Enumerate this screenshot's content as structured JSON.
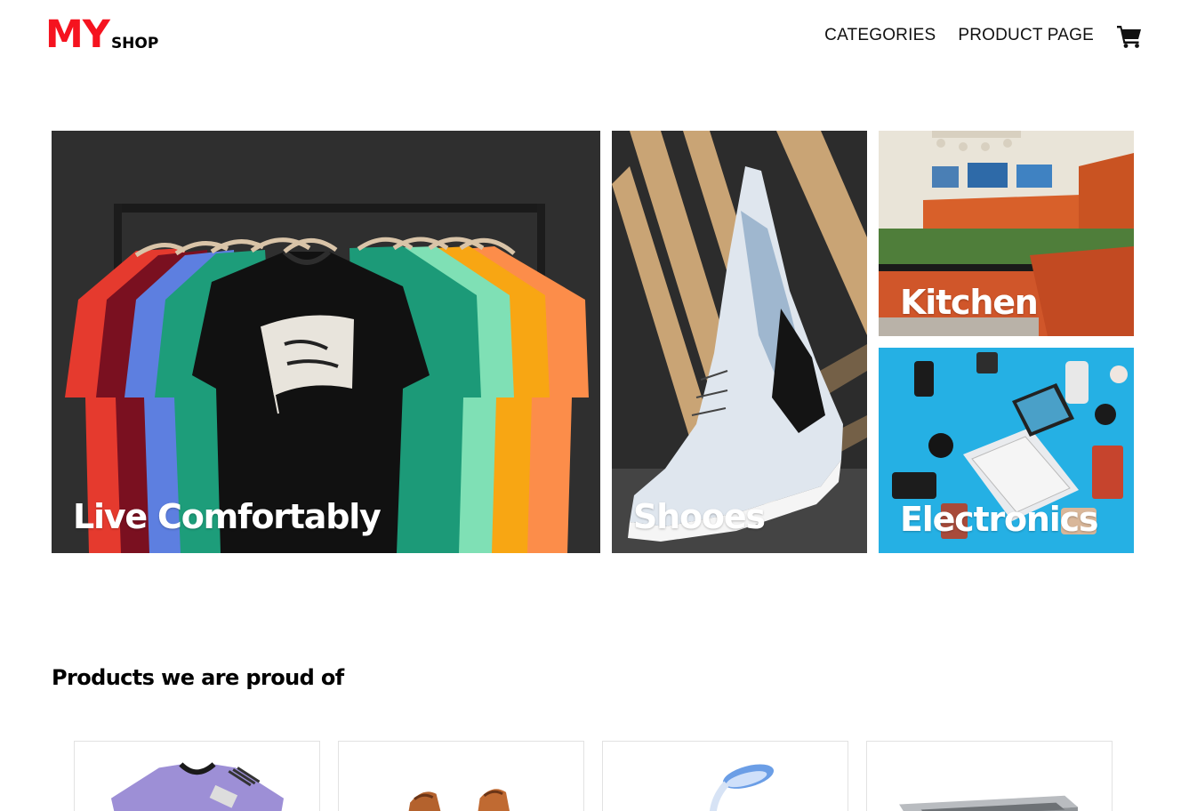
{
  "header": {
    "logo_main": "MY",
    "logo_sub": "SHOP",
    "nav": [
      {
        "label": "CATEGORIES"
      },
      {
        "label": "PRODUCT PAGE"
      }
    ],
    "cart_icon": "shopping-cart-icon"
  },
  "hero": {
    "main": {
      "label": "Live Comfortably"
    },
    "shoes": {
      "label": "Shooes"
    },
    "kitchen": {
      "label": "Kitchen"
    },
    "electronics": {
      "label": "Electronics"
    }
  },
  "products": {
    "title": "Products we are proud of",
    "items": [
      {
        "name": "jersey"
      },
      {
        "name": "shoes"
      },
      {
        "name": "desk-lamp"
      },
      {
        "name": "sink"
      }
    ]
  },
  "colors": {
    "brand_red": "#f5131f",
    "text": "#111111",
    "card_border": "#e2e2e2"
  }
}
